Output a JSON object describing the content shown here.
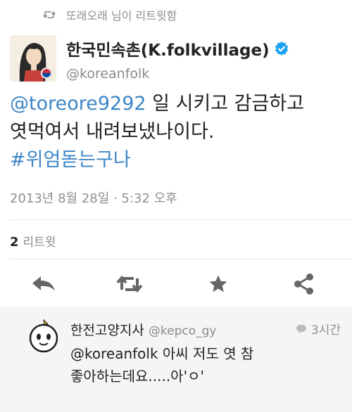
{
  "retweet_banner": {
    "text": "또래오래 님이 리트윗함",
    "icon": "retweet-icon"
  },
  "tweet": {
    "author_name": "한국민속촌(K.folkvillage)",
    "handle": "@koreanfolk",
    "verified": true,
    "mention": "@toreore9292",
    "text_part1": " 일 시키고 감금하고",
    "text_part2": "엿먹여서 내려보냈나이다.",
    "hashtag": "#위엄돋는구나",
    "timestamp": "2013년 8월 28일 · 5:32 오후",
    "retweet_count": "2",
    "retweet_label": "리트윗"
  },
  "actions": [
    {
      "name": "reply-icon"
    },
    {
      "name": "retweet-icon"
    },
    {
      "name": "star-icon"
    },
    {
      "name": "share-icon"
    }
  ],
  "reply": {
    "author_name": "한전고양지사",
    "handle": "@kepco_gy",
    "time": "3시간",
    "line1": "@koreanfolk 아씨 저도 엿 참",
    "line2": "좋아하는데요.....아'ㅇ'"
  },
  "colors": {
    "link": "#3e86c6",
    "verified": "#1da1f2",
    "icon": "#666666"
  }
}
